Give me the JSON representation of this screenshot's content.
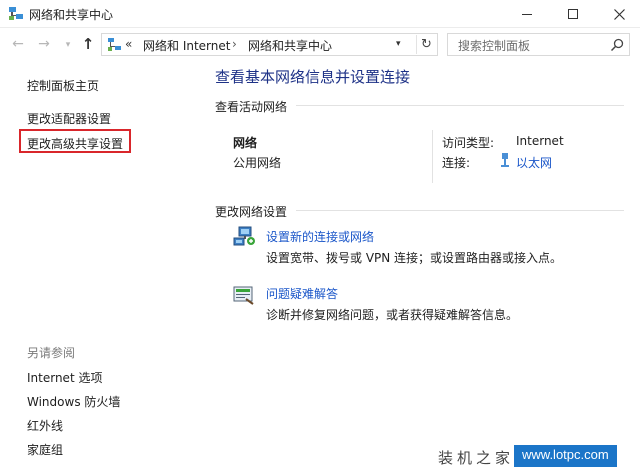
{
  "window": {
    "title": "网络和共享中心"
  },
  "nav": {
    "address_chevrons": "«",
    "breadcrumb": [
      "网络和 Internet",
      "网络和共享中心"
    ],
    "breadcrumb_sep": "›",
    "search_placeholder": "搜索控制面板"
  },
  "left_pane": {
    "links": [
      "控制面板主页",
      "更改适配器设置",
      "更改高级共享设置"
    ],
    "see_also_label": "另请参阅",
    "see_also": [
      "Internet 选项",
      "Windows 防火墙",
      "红外线",
      "家庭组"
    ],
    "highlight_color": "#d9262b"
  },
  "main": {
    "title": "查看基本网络信息并设置连接",
    "active_networks_heading": "查看活动网络",
    "network": {
      "name": "网络",
      "category": "公用网络",
      "access_type_label": "访问类型:",
      "access_type_value": "Internet",
      "connection_label": "连接:",
      "connection_value": "以太网"
    },
    "change_settings_heading": "更改网络设置",
    "tasks": [
      {
        "link": "设置新的连接或网络",
        "description": "设置宽带、拨号或 VPN 连接；或设置路由器或接入点。",
        "icon": "network-setup-icon"
      },
      {
        "link": "问题疑难解答",
        "description": "诊断并修复网络问题，或者获得疑难解答信息。",
        "icon": "troubleshoot-icon"
      }
    ]
  },
  "watermark": {
    "text": "装机之家",
    "url": "www.lotpc.com"
  },
  "colors": {
    "link": "#1a56c9",
    "title": "#1e3287",
    "watermark_bg": "#1b75c8"
  }
}
